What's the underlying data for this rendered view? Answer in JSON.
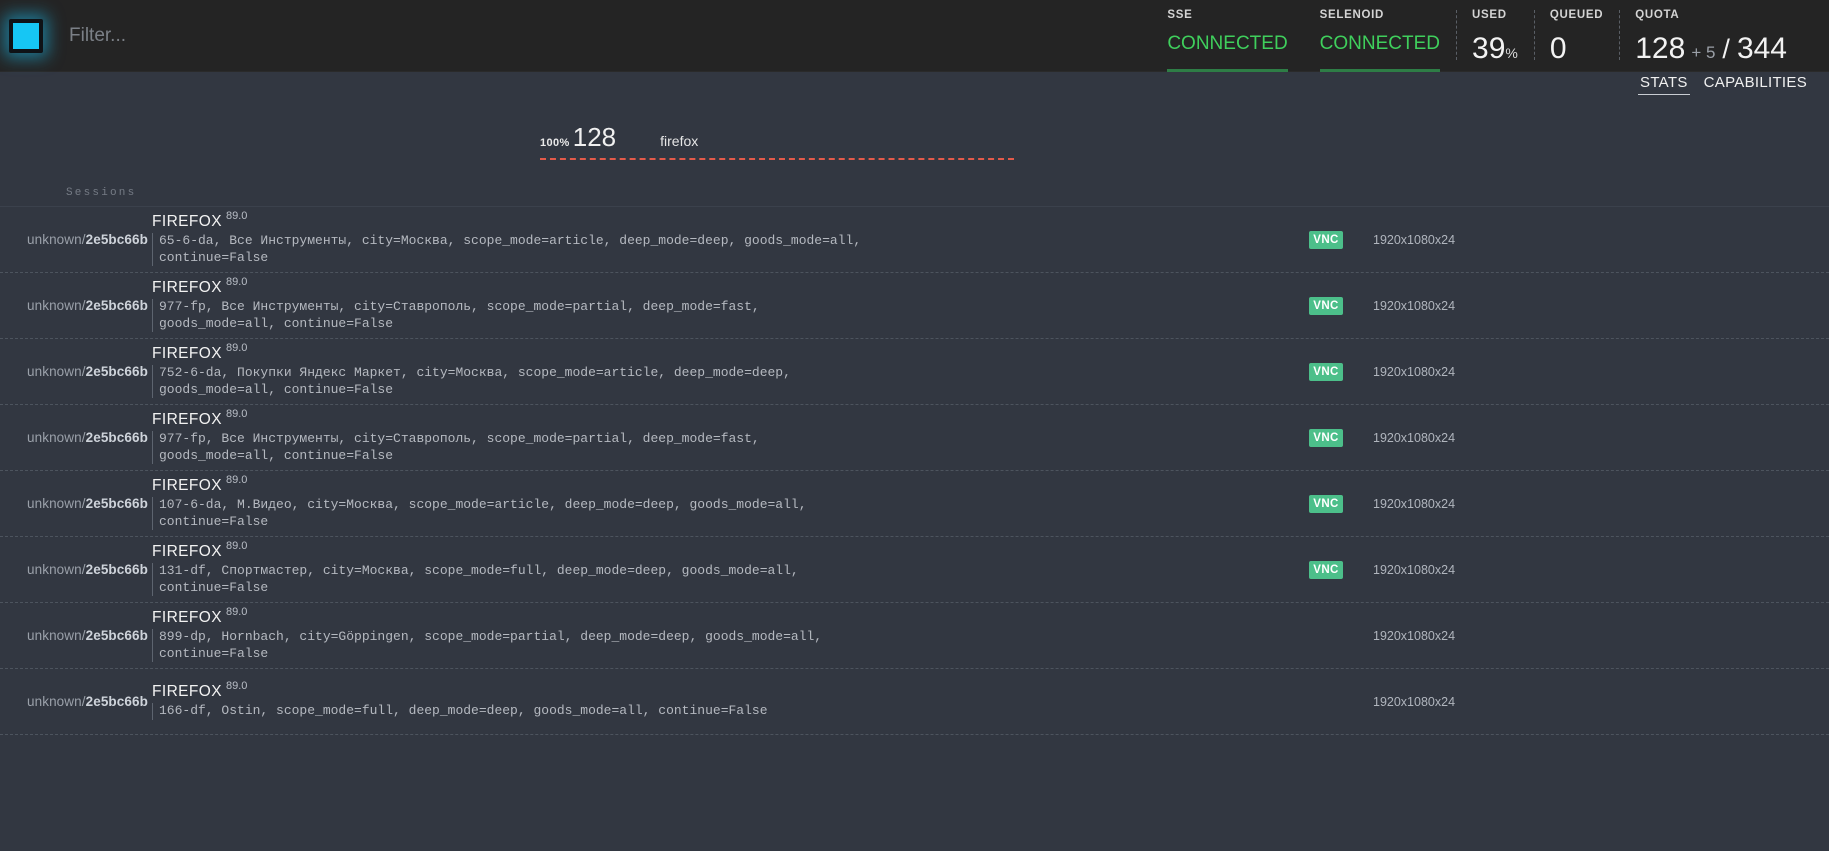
{
  "colors": {
    "header_bg": "#242424",
    "body_bg": "#323741",
    "accent_logo": "#16c6f4",
    "connected_green": "#3fcf5c",
    "vnc_badge_green": "#4cbf8a",
    "bar_red": "#e35a4a"
  },
  "header": {
    "logo_icon": "square-logo-icon",
    "filter": {
      "value": "",
      "placeholder": "Filter..."
    },
    "stats": [
      {
        "label": "SSE",
        "value": "CONNECTED",
        "type": "connected"
      },
      {
        "label": "SELENOID",
        "value": "CONNECTED",
        "type": "connected"
      },
      {
        "label": "USED",
        "value": "39",
        "unit": "%",
        "type": "number"
      },
      {
        "label": "QUEUED",
        "value": "0",
        "type": "number"
      },
      {
        "label": "QUOTA",
        "value": "128",
        "plus": "+ 5",
        "separator": "/",
        "total": "344",
        "type": "quota"
      }
    ]
  },
  "tabs": [
    {
      "label": "STATS",
      "active": true
    },
    {
      "label": "CAPABILITIES",
      "active": false
    }
  ],
  "chart_data": {
    "type": "bar",
    "title": "",
    "xlabel": "",
    "ylabel": "",
    "categories": [
      "firefox"
    ],
    "values": [
      128
    ],
    "percents": [
      "100%"
    ],
    "rows": [
      {
        "percent": "100%",
        "count": "128",
        "name": "firefox"
      }
    ],
    "grid": false,
    "legend": "none"
  },
  "sessions": {
    "section_title": "Sessions",
    "rows": [
      {
        "owner": "unknown",
        "separator": "/",
        "id": "2e5bc66b",
        "browser": "FIREFOX",
        "version": "89.0",
        "caps": "65-6-da, Все Инструменты, city=Москва, scope_mode=article, deep_mode=deep, goods_mode=all, continue=False",
        "vnc": "VNC",
        "has_vnc": true,
        "resolution": "1920x1080x24"
      },
      {
        "owner": "unknown",
        "separator": "/",
        "id": "2e5bc66b",
        "browser": "FIREFOX",
        "version": "89.0",
        "caps": "977-fp, Все Инструменты, city=Ставрополь, scope_mode=partial, deep_mode=fast, goods_mode=all, continue=False",
        "vnc": "VNC",
        "has_vnc": true,
        "resolution": "1920x1080x24"
      },
      {
        "owner": "unknown",
        "separator": "/",
        "id": "2e5bc66b",
        "browser": "FIREFOX",
        "version": "89.0",
        "caps": "752-6-da, Покупки Яндекс Маркет, city=Москва, scope_mode=article, deep_mode=deep, goods_mode=all, continue=False",
        "vnc": "VNC",
        "has_vnc": true,
        "resolution": "1920x1080x24"
      },
      {
        "owner": "unknown",
        "separator": "/",
        "id": "2e5bc66b",
        "browser": "FIREFOX",
        "version": "89.0",
        "caps": "977-fp, Все Инструменты, city=Ставрополь, scope_mode=partial, deep_mode=fast, goods_mode=all, continue=False",
        "vnc": "VNC",
        "has_vnc": true,
        "resolution": "1920x1080x24"
      },
      {
        "owner": "unknown",
        "separator": "/",
        "id": "2e5bc66b",
        "browser": "FIREFOX",
        "version": "89.0",
        "caps": "107-6-da, М.Видео, city=Москва, scope_mode=article, deep_mode=deep, goods_mode=all, continue=False",
        "vnc": "VNC",
        "has_vnc": true,
        "resolution": "1920x1080x24"
      },
      {
        "owner": "unknown",
        "separator": "/",
        "id": "2e5bc66b",
        "browser": "FIREFOX",
        "version": "89.0",
        "caps": "131-df, Спортмастер, city=Москва, scope_mode=full, deep_mode=deep, goods_mode=all, continue=False",
        "vnc": "VNC",
        "has_vnc": true,
        "resolution": "1920x1080x24"
      },
      {
        "owner": "unknown",
        "separator": "/",
        "id": "2e5bc66b",
        "browser": "FIREFOX",
        "version": "89.0",
        "caps": "899-dp, Hornbach, city=Göppingen, scope_mode=partial, deep_mode=deep, goods_mode=all, continue=False",
        "vnc": "",
        "has_vnc": false,
        "resolution": "1920x1080x24"
      },
      {
        "owner": "unknown",
        "separator": "/",
        "id": "2e5bc66b",
        "browser": "FIREFOX",
        "version": "89.0",
        "caps": "166-df, Ostin, scope_mode=full, deep_mode=deep, goods_mode=all, continue=False",
        "vnc": "",
        "has_vnc": false,
        "resolution": "1920x1080x24"
      }
    ]
  }
}
